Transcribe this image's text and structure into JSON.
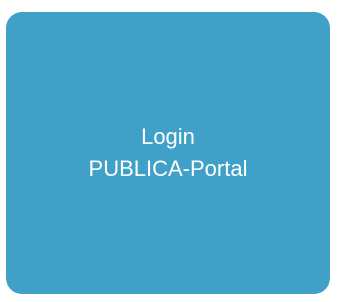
{
  "tile": {
    "line1": "Login",
    "line2": "PUBLICA-Portal",
    "background_color": "#3fa0c8",
    "text_color": "#ffffff"
  }
}
